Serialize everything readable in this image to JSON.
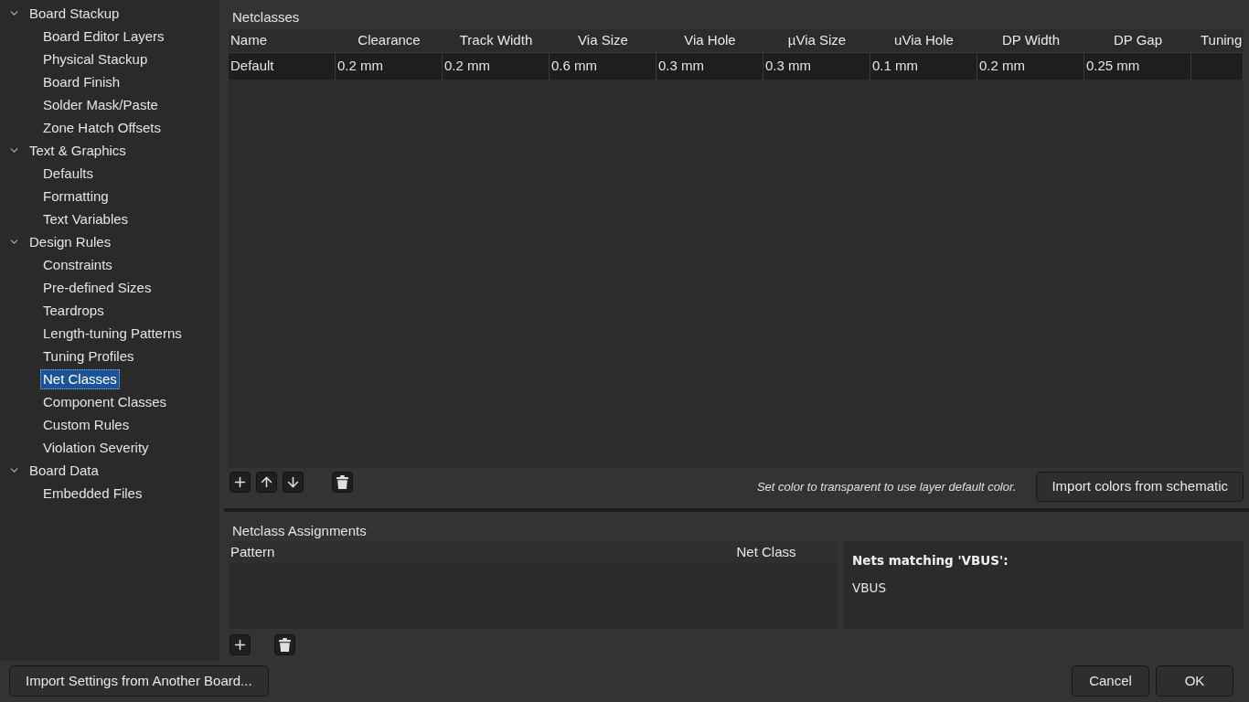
{
  "sidebar": {
    "tree": [
      {
        "label": "Board Stackup",
        "expanded": true,
        "selected": false,
        "children": [
          {
            "label": "Board Editor Layers",
            "selected": false
          },
          {
            "label": "Physical Stackup",
            "selected": false
          },
          {
            "label": "Board Finish",
            "selected": false
          },
          {
            "label": "Solder Mask/Paste",
            "selected": false
          },
          {
            "label": "Zone Hatch Offsets",
            "selected": false
          }
        ]
      },
      {
        "label": "Text & Graphics",
        "expanded": true,
        "selected": false,
        "children": [
          {
            "label": "Defaults",
            "selected": false
          },
          {
            "label": "Formatting",
            "selected": false
          },
          {
            "label": "Text Variables",
            "selected": false
          }
        ]
      },
      {
        "label": "Design Rules",
        "expanded": true,
        "selected": false,
        "children": [
          {
            "label": "Constraints",
            "selected": false
          },
          {
            "label": "Pre-defined Sizes",
            "selected": false
          },
          {
            "label": "Teardrops",
            "selected": false
          },
          {
            "label": "Length-tuning Patterns",
            "selected": false
          },
          {
            "label": "Tuning Profiles",
            "selected": false
          },
          {
            "label": "Net Classes",
            "selected": true
          },
          {
            "label": "Component Classes",
            "selected": false
          },
          {
            "label": "Custom Rules",
            "selected": false
          },
          {
            "label": "Violation Severity",
            "selected": false
          }
        ]
      },
      {
        "label": "Board Data",
        "expanded": true,
        "selected": false,
        "children": [
          {
            "label": "Embedded Files",
            "selected": false
          }
        ]
      }
    ]
  },
  "netclasses": {
    "title": "Netclasses",
    "columns": [
      "Name",
      "Clearance",
      "Track Width",
      "Via Size",
      "Via Hole",
      "µVia Size",
      "uVia Hole",
      "DP Width",
      "DP Gap",
      "Tuning"
    ],
    "rows": [
      {
        "cells": [
          "Default",
          "0.2 mm",
          "0.2 mm",
          "0.6 mm",
          "0.3 mm",
          "0.3 mm",
          "0.1 mm",
          "0.2 mm",
          "0.25 mm"
        ]
      }
    ],
    "hint": "Set color to transparent to use layer default color.",
    "import_button": "Import colors from schematic"
  },
  "assignments": {
    "title": "Netclass Assignments",
    "columns": [
      "Pattern",
      "Net Class"
    ],
    "matches": {
      "heading": "Nets matching 'VBUS':",
      "nets": [
        "VBUS"
      ]
    }
  },
  "footer": {
    "import_button": "Import Settings from Another Board...",
    "buttons": [
      "Cancel",
      "OK"
    ]
  }
}
